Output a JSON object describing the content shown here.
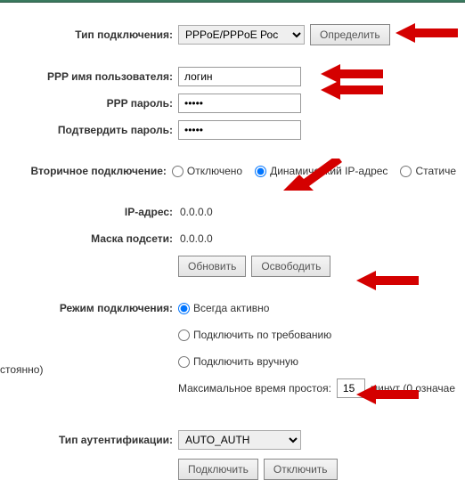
{
  "conn_type": {
    "label": "Тип подключения:",
    "value": "PPPoE/PPPoE Рос",
    "detect_btn": "Определить"
  },
  "ppp": {
    "username_label": "PPP имя пользователя:",
    "username_value": "логин",
    "password_label": "PPP пароль:",
    "password_value": "•••••",
    "confirm_label": "Подтвердить пароль:",
    "confirm_value": "•••••"
  },
  "secondary": {
    "label": "Вторичное подключение:",
    "opt_disabled": "Отключено",
    "opt_dynamic": "Динамический IP-адрес",
    "opt_static": "Статиче"
  },
  "ip": {
    "ip_label": "IP-адрес:",
    "ip_value": "0.0.0.0",
    "mask_label": "Маска подсети:",
    "mask_value": "0.0.0.0"
  },
  "buttons": {
    "refresh": "Обновить",
    "release": "Освободить",
    "connect": "Подключить",
    "disconnect": "Отключить"
  },
  "mode": {
    "label": "Режим подключения:",
    "always": "Всегда активно",
    "ondemand": "Подключить по требованию",
    "manual": "Подключить вручную",
    "idle_prefix": "Максимальное время простоя:",
    "idle_value": "15",
    "idle_suffix": "минут (0 означае"
  },
  "edge_text": "стоянно)",
  "auth": {
    "label": "Тип аутентификации:",
    "value": "AUTO_AUTH"
  }
}
